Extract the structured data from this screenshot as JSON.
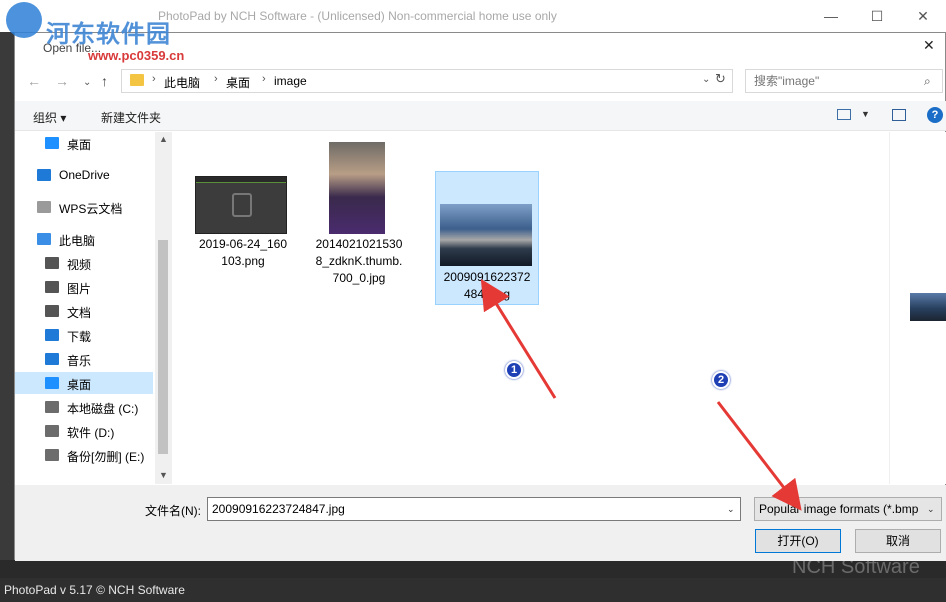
{
  "watermark": {
    "title": "河东软件园",
    "url": "www.pc0359.cn"
  },
  "app": {
    "title": "PhotoPad by NCH Software - (Unlicensed) Non-commercial home use only",
    "status": "PhotoPad v 5.17 © NCH Software",
    "brand_ghost": "NCH Software",
    "minimize": "—",
    "maximize": "☐",
    "close": "✕"
  },
  "dialog": {
    "title": "Open file...",
    "close": "✕",
    "nav": {
      "back": "←",
      "forward": "→",
      "dropdown": "⌄",
      "up": "↑",
      "breadcrumb": [
        "此电脑",
        "桌面",
        "image"
      ],
      "sep": "›",
      "refresh": "↻"
    },
    "search": {
      "placeholder": "搜索\"image\"",
      "icon": "⌕"
    },
    "toolbar": {
      "organize": "组织 ▾",
      "new_folder": "新建文件夹",
      "help": "?"
    },
    "sidebar": [
      {
        "label": "桌面",
        "icon": "desktop-icon",
        "color": "#1e90ff"
      },
      {
        "label": "OneDrive",
        "icon": "cloud-icon",
        "color": "#1e7ad6"
      },
      {
        "label": "WPS云文档",
        "icon": "document-icon",
        "color": "#9a9a9a"
      },
      {
        "label": "此电脑",
        "icon": "computer-icon",
        "color": "#3a8ee6"
      },
      {
        "label": "视频",
        "icon": "video-icon",
        "color": "#555555"
      },
      {
        "label": "图片",
        "icon": "picture-icon",
        "color": "#555555"
      },
      {
        "label": "文档",
        "icon": "document-icon",
        "color": "#555555"
      },
      {
        "label": "下载",
        "icon": "download-icon",
        "color": "#1e7ad6"
      },
      {
        "label": "音乐",
        "icon": "music-icon",
        "color": "#1e7ad6"
      },
      {
        "label": "桌面",
        "icon": "desktop-icon",
        "color": "#1e90ff",
        "selected": true
      },
      {
        "label": "本地磁盘 (C:)",
        "icon": "drive-icon",
        "color": "#6c6c6c"
      },
      {
        "label": "软件 (D:)",
        "icon": "drive-icon",
        "color": "#6c6c6c"
      },
      {
        "label": "备份[勿删] (E:)",
        "icon": "drive-icon",
        "color": "#6c6c6c"
      }
    ],
    "scroll": {
      "up": "▲",
      "down": "▼"
    },
    "files": [
      {
        "name_lines": [
          "2019-06-24_160",
          "103.png"
        ]
      },
      {
        "name_lines": [
          "2014021021530",
          "8_zdknK.thumb.",
          "700_0.jpg"
        ]
      },
      {
        "name_lines": [
          "2009091622372",
          "4847.jpg"
        ],
        "selected": true
      }
    ],
    "bottom": {
      "filename_label": "文件名(N):",
      "filename_value": "20090916223724847.jpg",
      "filetype": "Popular image formats (*.bmp",
      "open_label": "打开(O)",
      "cancel_label": "取消",
      "dropdown": "⌄"
    }
  },
  "annotations": {
    "one": "1",
    "two": "2",
    "arrow_color": "#e53935"
  }
}
